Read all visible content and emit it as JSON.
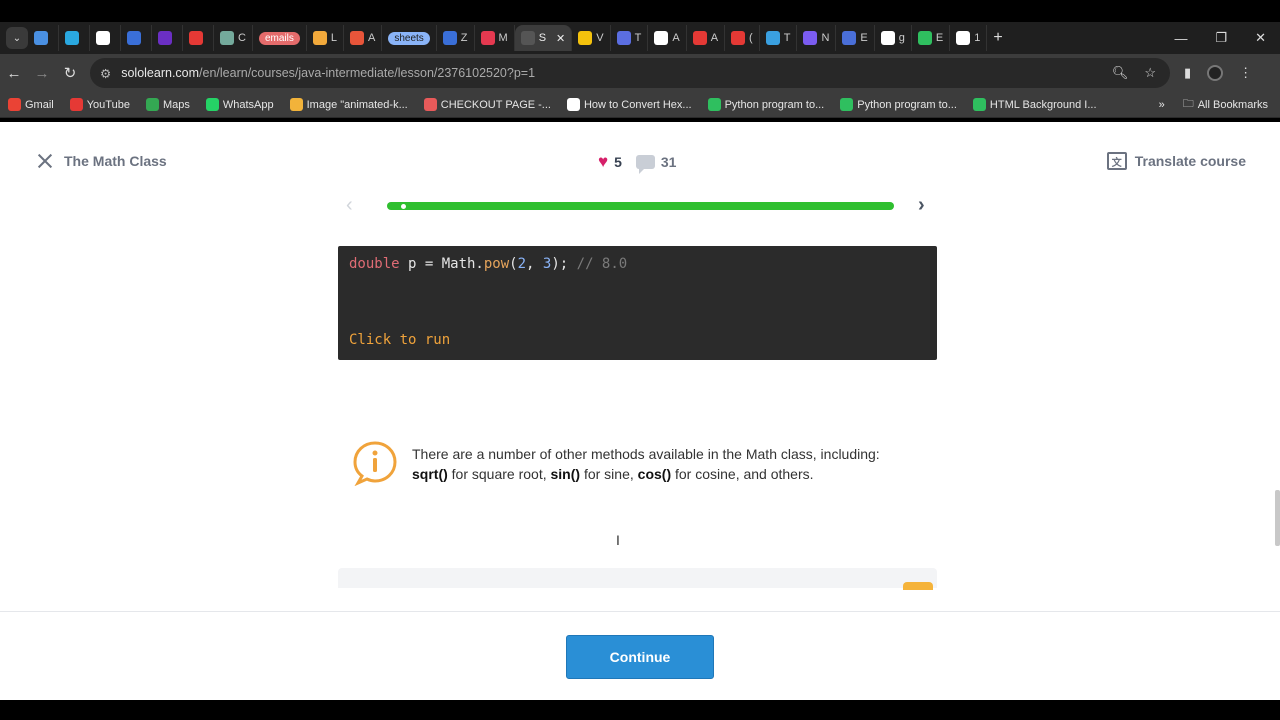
{
  "browser": {
    "tabs": [
      {
        "label": "",
        "icon": "gmail-m-icon",
        "color": "#4a90e2"
      },
      {
        "label": "",
        "icon": "play-icon",
        "color": "#2aa8e0"
      },
      {
        "label": "",
        "icon": "circle-c-icon",
        "color": "#ffffff"
      },
      {
        "label": "",
        "icon": "w-icon",
        "color": "#3a6fd8"
      },
      {
        "label": "",
        "icon": "up-icon",
        "color": "#6b2fc4"
      },
      {
        "label": "",
        "icon": "youtube-icon",
        "color": "#e53935"
      },
      {
        "label": "C",
        "icon": "chatgpt-icon",
        "color": "#74aa9c"
      },
      {
        "label": "emails",
        "pill": "red"
      },
      {
        "label": "L",
        "icon": "maps-pin-icon",
        "color": "#f2a93b"
      },
      {
        "label": "A",
        "icon": "maps-pin-icon",
        "color": "#e8553a"
      },
      {
        "label": "sheets",
        "pill": "blue"
      },
      {
        "label": "Z",
        "icon": "z-icon",
        "color": "#3a6fd8"
      },
      {
        "label": "M",
        "icon": "m-icon",
        "color": "#e53950"
      },
      {
        "label": "S",
        "icon": "s-icon",
        "color": "#555555",
        "active": true
      },
      {
        "label": "V",
        "icon": "drive-icon",
        "color": "#f4c20d"
      },
      {
        "label": "T",
        "icon": "globe-icon",
        "color": "#5b6ee1"
      },
      {
        "label": "A",
        "icon": "d-icon",
        "color": "#ffffff"
      },
      {
        "label": "A",
        "icon": "co-icon",
        "color": "#e53935"
      },
      {
        "label": "(",
        "icon": "youtube-icon",
        "color": "#e53935"
      },
      {
        "label": "T",
        "icon": "circle-c-icon",
        "color": "#3aa0e0"
      },
      {
        "label": "N",
        "icon": "video-icon",
        "color": "#7b5cf0"
      },
      {
        "label": "E",
        "icon": "edit-icon",
        "color": "#4a6fd8"
      },
      {
        "label": "g",
        "icon": "google-icon",
        "color": "#ffffff"
      },
      {
        "label": "E",
        "icon": "s-green-icon",
        "color": "#2fbf5f"
      },
      {
        "label": "1",
        "icon": "google-icon",
        "color": "#ffffff"
      }
    ],
    "tab_close": "✕",
    "new_tab": "+",
    "url_host": "sololearn.com",
    "url_path": "/en/learn/courses/java-intermediate/lesson/2376102520?p=1",
    "bookmarks": [
      {
        "label": "Gmail",
        "color": "#ea4335"
      },
      {
        "label": "YouTube",
        "color": "#e53935"
      },
      {
        "label": "Maps",
        "color": "#34a853"
      },
      {
        "label": "WhatsApp",
        "color": "#25d366"
      },
      {
        "label": "Image \"animated-k...",
        "color": "#f2b33a"
      },
      {
        "label": "CHECKOUT PAGE -...",
        "color": "#e85a5a"
      },
      {
        "label": "How to Convert Hex...",
        "color": "#ffffff"
      },
      {
        "label": "Python program to...",
        "color": "#2fbf5f"
      },
      {
        "label": "Python program to...",
        "color": "#2fbf5f"
      },
      {
        "label": "HTML Background I...",
        "color": "#2fbf5f"
      }
    ],
    "bookmarks_more": "»",
    "all_bookmarks": "All Bookmarks"
  },
  "lesson": {
    "title": "The Math Class",
    "likes": "5",
    "comments": "31",
    "translate": "Translate course",
    "progress": 0.04,
    "code": {
      "line_kw": "double",
      "line_mid": " p = Math.",
      "line_fn": "pow",
      "line_open": "(",
      "arg1": "2",
      "comma": ", ",
      "arg2": "3",
      "close": "); ",
      "comment": "// 8.0",
      "run_label": "Click to run"
    },
    "info": {
      "text1": "There are a number of other methods available in the Math class, including:",
      "sqrt": "sqrt()",
      "t2": " for square root, ",
      "sin": "sin()",
      "t3": " for sine, ",
      "cos": "cos()",
      "t4": " for cosine, and others."
    },
    "continue": "Continue"
  },
  "colors": {
    "accent_green": "#2fbf2f",
    "button_blue": "#2a8fd6",
    "heart": "#d61f69",
    "info_orange": "#f0a33b"
  }
}
